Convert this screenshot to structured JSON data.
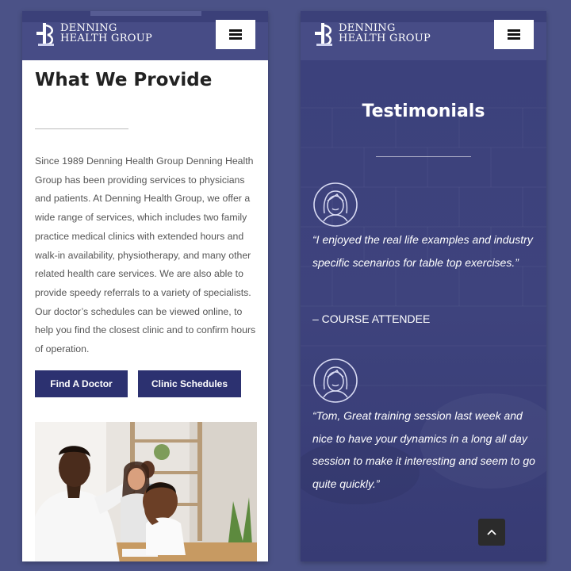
{
  "brand": {
    "line1": "Denning",
    "line2": "Health Group"
  },
  "about": {
    "title": "What We Provide",
    "body": "Since 1989 Denning Health Group Denning Health Group has been providing services to physicians and patients. At Denning Health Group, we offer a wide range of services, which includes two family practice medical clinics with extended hours and walk-in availability, physiotherapy, and many other related health care services. We are also able to provide speedy referrals to a variety of specialists. Our doctor’s schedules can be viewed online, to help you find the closest clinic and to confirm hours of operation.",
    "buttons": {
      "find_doctor": "Find A Doctor",
      "clinic_schedules": "Clinic Schedules"
    }
  },
  "testimonials": {
    "title": "Testimonials",
    "items": [
      {
        "quote": "“I enjoyed the real life examples and industry specific scenarios for table top exercises.”",
        "author": "– COURSE ATTENDEE"
      },
      {
        "quote": "“Tom, Great training session last week and nice to have your dynamics in a long all day session to make it interesting and seem to go quite quickly.”"
      }
    ]
  },
  "icons": {
    "menu": "hamburger-icon",
    "scroll_top": "chevron-up-icon",
    "avatar": "woman-avatar-icon"
  },
  "colors": {
    "page_background": "#4b5287",
    "header": "#3b4079",
    "button": "#2c3170",
    "testimonial_background": "#3a3f7a"
  }
}
